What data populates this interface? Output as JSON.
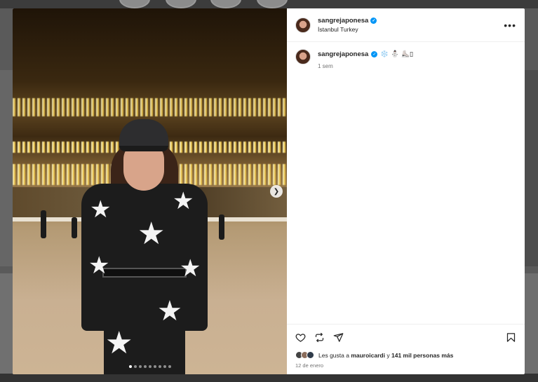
{
  "post": {
    "username": "sangrejaponesa",
    "location": "İstanbul Turkey",
    "more_icon": "more-horizontal-icon"
  },
  "caption": {
    "username": "sangrejaponesa",
    "emojis": "❄️ ⛄ ⛸️▯",
    "time_ago": "1 sem"
  },
  "media": {
    "slide_count": 9,
    "active_slide": 1,
    "next_icon": "chevron-right-icon"
  },
  "actions": {
    "like_icon": "heart-icon",
    "repost_icon": "repost-icon",
    "share_icon": "send-icon",
    "save_icon": "bookmark-icon"
  },
  "likes": {
    "prefix": "Les gusta a",
    "user": "mauroicardi",
    "connector": "y",
    "others": "141 mil personas más"
  },
  "date": "12 de enero",
  "colors": {
    "verified": "#0095f6",
    "text": "#262626",
    "muted": "#737373"
  }
}
